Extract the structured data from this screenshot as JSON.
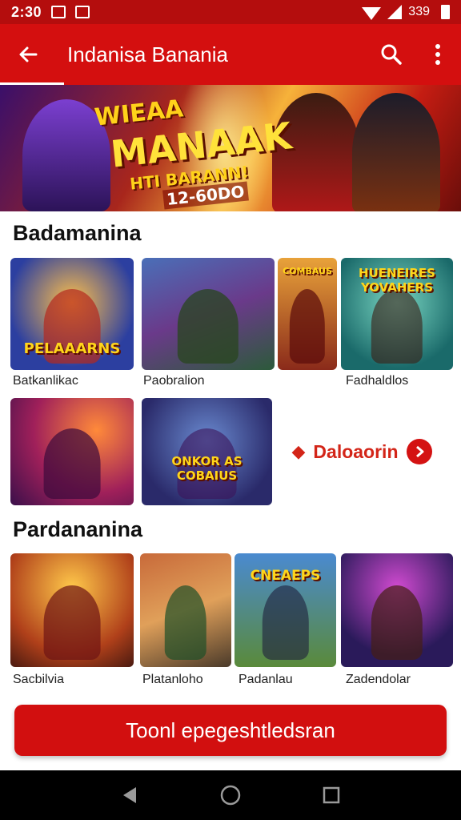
{
  "status_bar": {
    "time": "2:30",
    "battery_text": "339"
  },
  "app_bar": {
    "title": "Indanisa Banania"
  },
  "banner": {
    "line1": "WIEAA",
    "line2": "MANAAK",
    "line3": "HTI BARANN!",
    "line4": "12-60DO"
  },
  "section1": {
    "title": "Badamanina",
    "tiles": [
      {
        "caption": "PELAAARNS",
        "label": "Batkanlikac"
      },
      {
        "caption": "",
        "label": "Paobralion"
      },
      {
        "caption": "COMBAUS",
        "label": ""
      },
      {
        "caption": "HUENEIRES YOVAHERS",
        "label": "Fadhaldlos"
      }
    ],
    "row2": [
      {
        "caption": ""
      },
      {
        "caption": "ONKOR AS COBAIUS"
      }
    ],
    "ad": {
      "text": "Daloaorin"
    }
  },
  "section2": {
    "title": "Pardananina",
    "tiles": [
      {
        "caption": "",
        "label": "Sacbilvia"
      },
      {
        "caption": "",
        "label": "Platanloho"
      },
      {
        "caption": "CNEAEPS",
        "label": "Padanlau"
      },
      {
        "caption": "",
        "label": "Zadendolar"
      }
    ]
  },
  "cta": {
    "label": "Toonl epegeshtledsran"
  },
  "colors": {
    "primary": "#d40f0f",
    "status": "#b40d0d",
    "accent_gold": "#ffd51a"
  },
  "icons": [
    "back-arrow-icon",
    "search-icon",
    "more-vert-icon",
    "nav-back-icon",
    "nav-home-icon",
    "nav-recents-icon"
  ]
}
